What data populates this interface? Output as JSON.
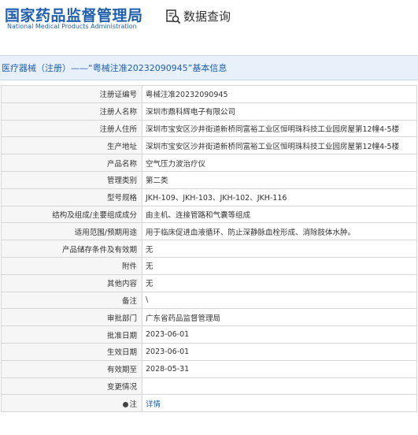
{
  "header": {
    "org_cn": "国家药品监督管理局",
    "org_en": "National Medical Products Administration",
    "query_label": "数据查询",
    "query_icon": "search-document-icon"
  },
  "title": "医疗器械（注册）——“粤械注准20232090945”基本信息",
  "rows": [
    {
      "label": "注册证编号",
      "value": "粤械注准20232090945"
    },
    {
      "label": "注册人名称",
      "value": "深圳市鼎科辉电子有限公司"
    },
    {
      "label": "注册人住所",
      "value": "深圳市宝安区沙井街道新桥同富裕工业区恒明珠科技工业园房屋第12幢4-5楼"
    },
    {
      "label": "生产地址",
      "value": "深圳市宝安区沙井街道新桥同富裕工业区恒明珠科技工业园房屋第12幢4-5楼"
    },
    {
      "label": "产品名称",
      "value": "空气压力波治疗仪"
    },
    {
      "label": "管理类别",
      "value": "第二类"
    },
    {
      "label": "型号规格",
      "value": "JKH-109、JKH-103、JKH-102、JKH-116"
    },
    {
      "label": "结构及组成/主要组成成分",
      "value": "由主机、连接管路和气囊等组成"
    },
    {
      "label": "适用范围/预期用途",
      "value": "用于临床促进血液循环、防止深静脉血栓形成、消除肢体水肿。"
    },
    {
      "label": "产品储存条件及有效期",
      "value": "无"
    },
    {
      "label": "附件",
      "value": "无"
    },
    {
      "label": "其他内容",
      "value": "无"
    },
    {
      "label": "备注",
      "value": "\\"
    },
    {
      "label": "审批部门",
      "value": "广东省药品监督管理局"
    },
    {
      "label": "批准日期",
      "value": "2023-06-01"
    },
    {
      "label": "生效日期",
      "value": "2023-06-01"
    },
    {
      "label": "有效期至",
      "value": "2028-05-31"
    },
    {
      "label": "变更情况",
      "value": ""
    }
  ],
  "note": {
    "label": "注",
    "link": "详情",
    "icon": "note-dot-icon"
  },
  "colors": {
    "brand": "#1f5fae",
    "title_bg": "#e8f0fa",
    "label_bg": "#f6f6f6"
  }
}
